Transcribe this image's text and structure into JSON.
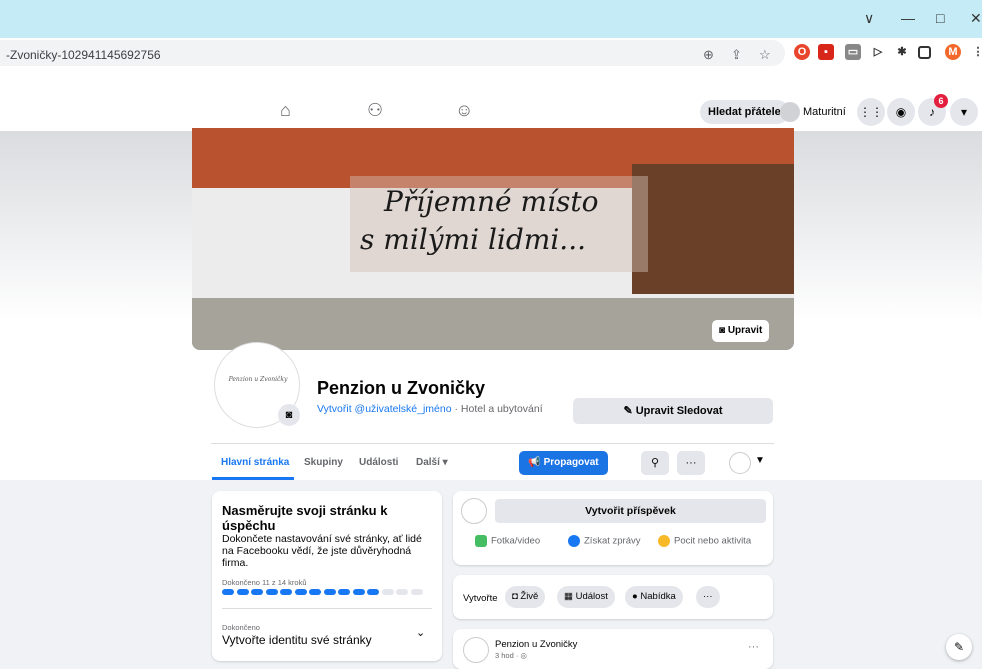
{
  "browser": {
    "address_text": "-Zvoničky-102941145692756",
    "window_controls": {
      "minimize": "—",
      "maximize": "□",
      "close": "✕",
      "menu": "∨"
    },
    "profile_initial": "M"
  },
  "nav": {
    "find_friends": "Hledat přátele",
    "profile_name": "Maturitní",
    "notification_count": "6"
  },
  "cover": {
    "text_line1": "Příjemné místo",
    "text_line2": "s milými lidmi...",
    "edit_label": "Upravit"
  },
  "profile": {
    "avatar_logo_text": "Penzion u Zvoničky",
    "name": "Penzion u Zvoničky",
    "username_link": "Vytvořit @uživatelské_jméno",
    "category": " · Hotel a ubytování",
    "edit_follow": "Upravit Sledovat"
  },
  "tabs": {
    "items": [
      "Hlavní stránka",
      "Skupiny",
      "Události",
      "Další ▾"
    ],
    "promote": "Propagovat",
    "more_dots": "···"
  },
  "guide": {
    "title": "Nasměrujte svoji stránku k úspěchu",
    "description": "Dokončete nastavování své stránky, ať lidé na Facebooku vědí, že jste důvěryhodná firma.",
    "progress_label": "Dokončeno 11 z 14 kroků",
    "progress_done": 11,
    "progress_total": 14,
    "done_label": "Dokončeno",
    "step_title": "Vytvořte identitu své stránky"
  },
  "composer": {
    "create_post": "Vytvořit příspěvek",
    "actions": [
      "Fotka/video",
      "Získat zprávy",
      "Pocit nebo aktivita"
    ]
  },
  "create_row": {
    "label": "Vytvořte",
    "pills": [
      "Živě",
      "Událost",
      "Nabídka"
    ],
    "more": "···"
  },
  "feed": {
    "name": "Penzion u Zvoničky",
    "time": "3 hod · ◎",
    "dots": "···"
  },
  "colors": {
    "accent": "#1877f2",
    "badge": "#e41e3f",
    "chrome_bar": "#c5ecf6"
  }
}
